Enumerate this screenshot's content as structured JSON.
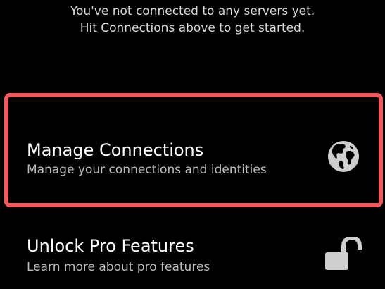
{
  "empty_state": {
    "line1": "You've not connected to any servers yet.",
    "line2": "Hit Connections above to get started."
  },
  "menu": {
    "manage": {
      "title": "Manage Connections",
      "subtitle": "Manage your connections and identities",
      "icon": "globe-icon"
    },
    "unlock": {
      "title": "Unlock Pro Features",
      "subtitle": "Learn more about pro features",
      "icon": "unlocked-padlock-icon"
    }
  },
  "colors": {
    "background": "#000000",
    "highlight_border": "#ef5a5f",
    "icon": "#cfcfcf",
    "subtitle": "#bdbdbd"
  }
}
